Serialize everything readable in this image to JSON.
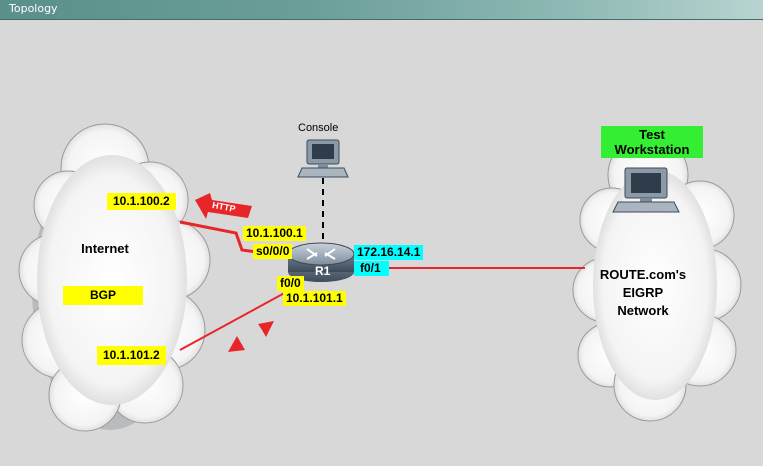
{
  "window": {
    "title": "Topology"
  },
  "internet": {
    "title": "Internet",
    "protocol": "BGP"
  },
  "router": {
    "name": "R1"
  },
  "console": {
    "label": "Console"
  },
  "route_network": {
    "name": "ROUTE.com's\nEIGRP\nNetwork"
  },
  "workstation": {
    "label": "Test\nWorkstation"
  },
  "links": {
    "http_label": "HTTP",
    "serial_far_ip": "10.1.100.2",
    "serial_near_ip": "10.1.100.1",
    "serial_if": "s0/0/0",
    "fa00_if": "f0/0",
    "fa00_ip": "10.1.101.1",
    "fa00_far_ip": "10.1.101.2",
    "fa01_ip": "172.16.14.1",
    "fa01_if": "f0/1"
  },
  "colors": {
    "link": "#e8262a",
    "label_yellow": "#ffff00",
    "label_cyan": "#00ffff",
    "label_green": "#33ee33"
  }
}
